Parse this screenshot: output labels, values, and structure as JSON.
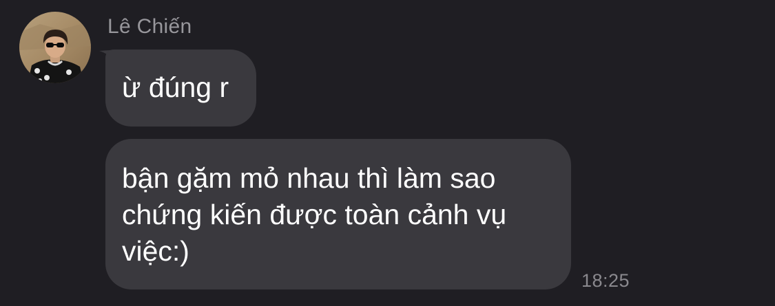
{
  "conversation": {
    "sender": {
      "name": "Lê Chiến"
    },
    "messages": [
      {
        "text": "ừ đúng r"
      },
      {
        "text": "bận gặm mỏ nhau thì làm sao chứng kiến được toàn cảnh vụ việc:)"
      }
    ],
    "last_timestamp": "18:25"
  }
}
